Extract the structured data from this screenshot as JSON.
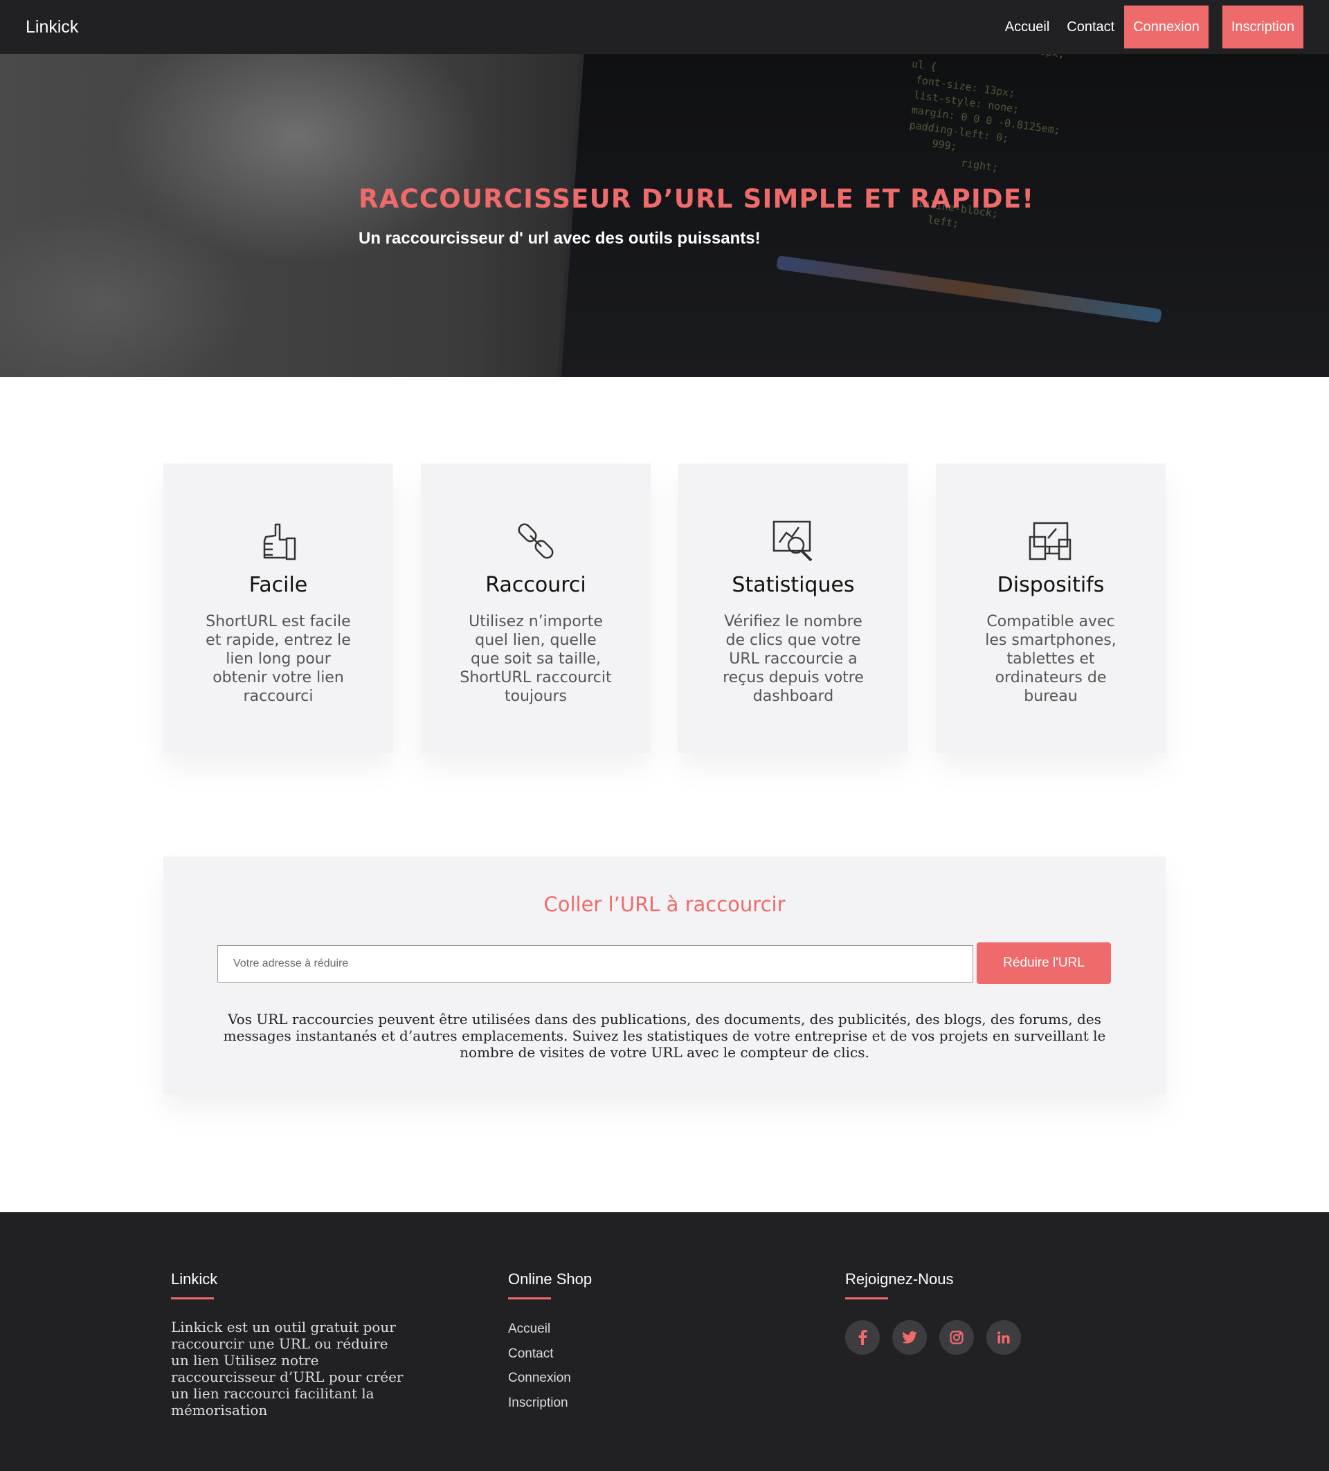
{
  "navbar": {
    "brand": "Linkick",
    "links": [
      "Accueil",
      "Contact"
    ],
    "login_label": "Connexion",
    "signup_label": "Inscription"
  },
  "hero": {
    "title": "RACCOURCISSEUR D’URL SIMPLE ET RAPIDE!",
    "subtitle": "Un raccourcisseur d' url avec des outils puissants!"
  },
  "features": [
    {
      "icon": "thumbs-up-icon",
      "title": "Facile",
      "description": "ShortURL est facile et rapide, entrez le lien long pour obtenir votre lien raccourci"
    },
    {
      "icon": "link-icon",
      "title": "Raccourci",
      "description": "Utilisez n’importe quel lien, quelle que soit sa taille, ShortURL raccourcit toujours"
    },
    {
      "icon": "stats-icon",
      "title": "Statistiques",
      "description": "Vérifiez le nombre de clics que votre URL raccourcie a reçus depuis votre dashboard"
    },
    {
      "icon": "devices-icon",
      "title": "Dispositifs",
      "description": "Compatible avec les smartphones, tablettes et ordinateurs de bureau"
    }
  ],
  "shortener": {
    "title": "Coller l’URL à raccourcir",
    "input_placeholder": "Votre adresse à réduire",
    "input_value": "",
    "button_label": "Réduire l'URL",
    "text": "Vos URL raccourcies peuvent être utilisées dans des publications, des documents, des publicités, des blogs, des forums, des messages instantanés et d’autres emplacements. Suivez les statistiques de votre entreprise et de vos projets en surveillant le nombre de visites de votre URL avec le compteur de clics."
  },
  "footer": {
    "about": {
      "title": "Linkick",
      "text": "Linkick est un outil gratuit pour raccourcir une URL ou réduire un lien Utilisez notre raccourcisseur d’URL pour créer un lien raccourci facilitant la mémorisation"
    },
    "shop": {
      "title": "Online Shop",
      "links": [
        "Accueil",
        "Contact",
        "Connexion",
        "Inscription"
      ]
    },
    "social": {
      "title": "Rejoignez-Nous",
      "icons": [
        "facebook-icon",
        "twitter-icon",
        "instagram-icon",
        "linkedin-icon"
      ]
    }
  },
  "colors": {
    "accent": "#ef6b6b",
    "dark": "#212124",
    "card": "#f3f2f4"
  }
}
